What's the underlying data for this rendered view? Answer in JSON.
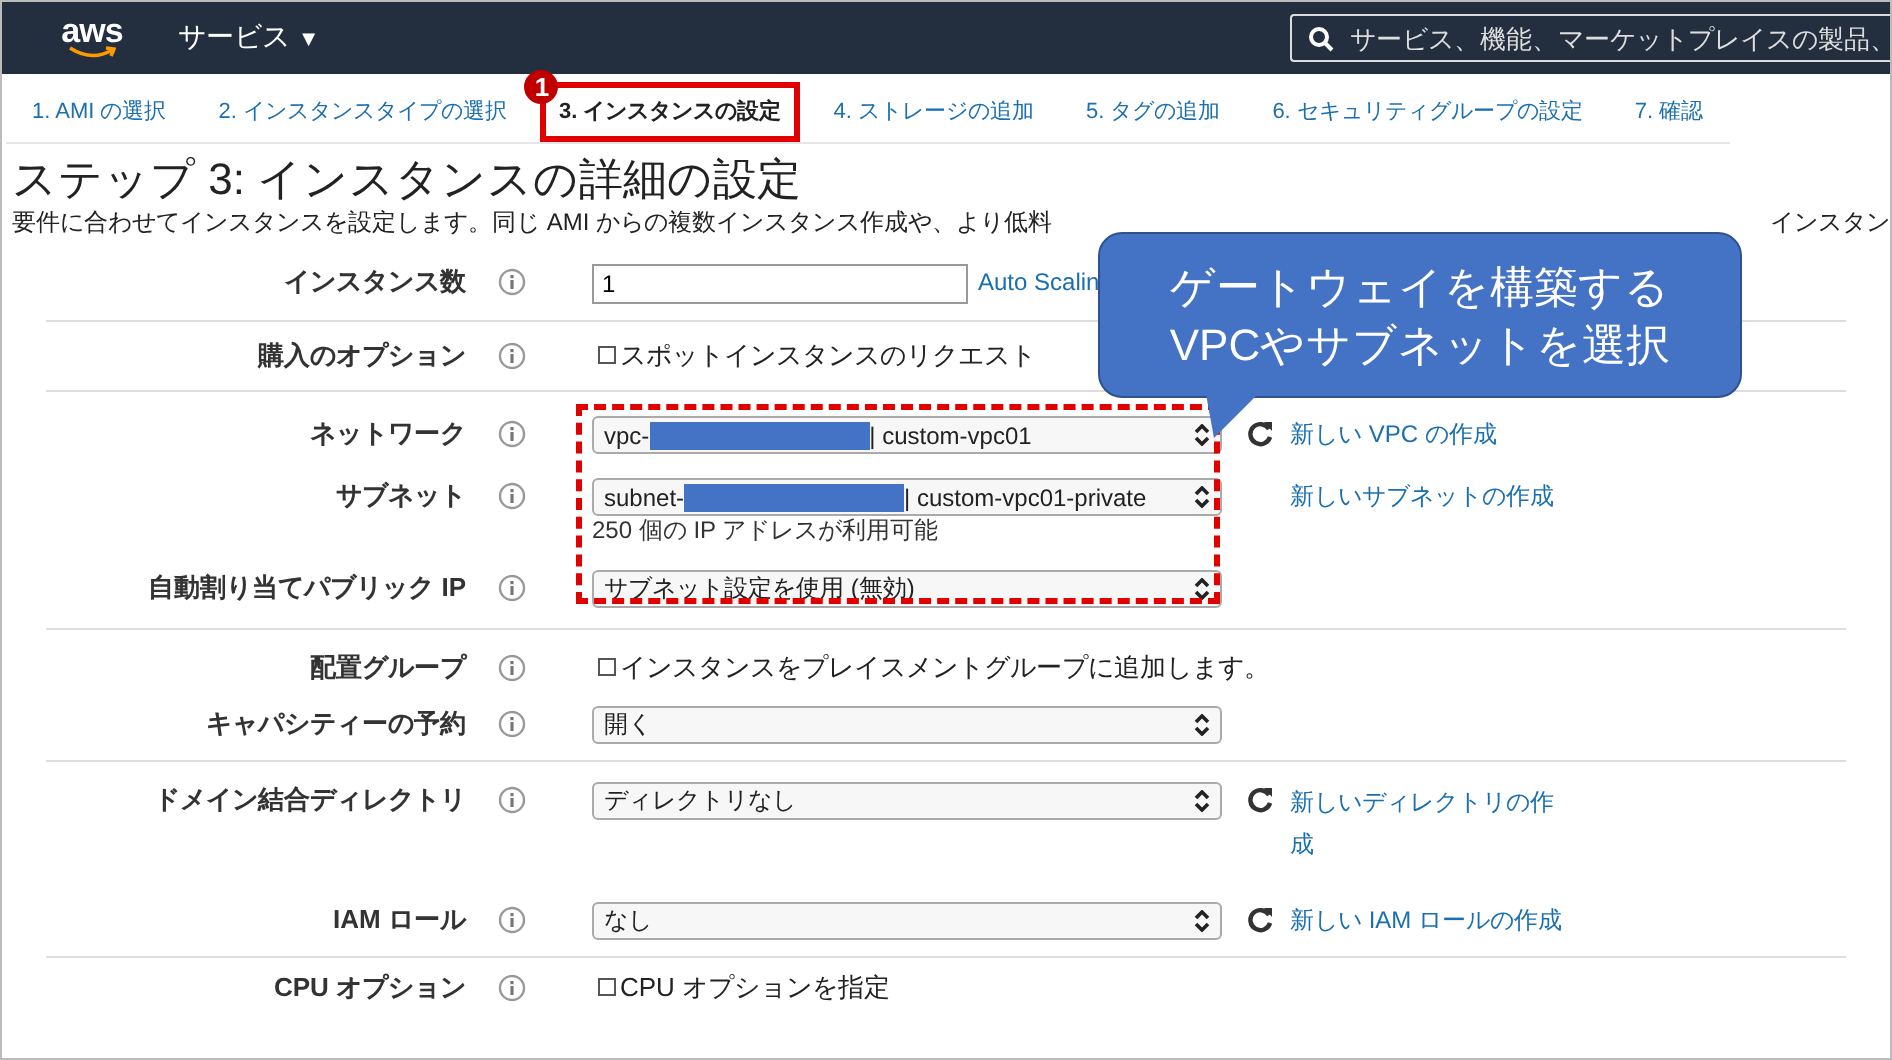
{
  "header": {
    "logo": "aws",
    "services_menu": {
      "label": "サービス",
      "caret": "▼"
    },
    "search": {
      "placeholder": "サービス、機能、マーケットプレイスの製品、"
    }
  },
  "tabs": [
    {
      "label": "1. AMI の選択",
      "selected": false
    },
    {
      "label": "2. インスタンスタイプの選択",
      "selected": false
    },
    {
      "label": "3. インスタンスの設定",
      "selected": true
    },
    {
      "label": "4. ストレージの追加",
      "selected": false
    },
    {
      "label": "5. タグの追加",
      "selected": false
    },
    {
      "label": "6. セキュリティグループの設定",
      "selected": false
    },
    {
      "label": "7. 確認",
      "selected": false
    }
  ],
  "step_badge": "1",
  "title": "ステップ 3: インスタンスの詳細の設定",
  "description": {
    "start": "要件に合わせてインスタンスを設定します。同じ AMI からの複数インスタンス作成や、より低料",
    "end": "インスタン"
  },
  "sections": [
    {
      "rows": [
        {
          "label": "インスタンス数",
          "kind": "input",
          "value": "1",
          "link": "Auto Scalin"
        }
      ]
    },
    {
      "rows": [
        {
          "label": "購入のオプション",
          "kind": "checkbox",
          "text": "スポットインスタンスのリクエスト",
          "checked": false
        }
      ]
    },
    {
      "highlighted": true,
      "rows": [
        {
          "label": "ネットワーク",
          "kind": "select",
          "prefix": "vpc-",
          "redacted": true,
          "value": " | custom-vpc01",
          "refresh": true,
          "link": "新しい VPC の作成"
        },
        {
          "label": "サブネット",
          "kind": "select",
          "prefix": "subnet-",
          "redacted": true,
          "value": " | custom-vpc01-private",
          "refresh": false,
          "link": "新しいサブネットの作成",
          "note": "250 個の IP アドレスが利用可能"
        },
        {
          "label": "自動割り当てパブリック IP",
          "kind": "select",
          "value": "サブネット設定を使用 (無効)",
          "refresh": false
        }
      ]
    },
    {
      "rows": [
        {
          "label": "配置グループ",
          "kind": "checkbox",
          "text": "インスタンスをプレイスメントグループに追加します。",
          "checked": false
        },
        {
          "label": "キャパシティーの予約",
          "kind": "select",
          "value": "開く",
          "refresh": false
        }
      ]
    },
    {
      "rows": [
        {
          "label": "ドメイン結合ディレクトリ",
          "kind": "select",
          "value": "ディレクトリなし",
          "refresh": true,
          "link": "新しいディレクトリの作成",
          "wrap_link": true
        },
        {
          "label": "IAM ロール",
          "kind": "select",
          "value": "なし",
          "refresh": true,
          "link": "新しい IAM ロールの作成"
        }
      ]
    },
    {
      "rows": [
        {
          "label": "CPU オプション",
          "kind": "checkbox",
          "text": "CPU オプションを指定",
          "checked": false
        }
      ]
    }
  ],
  "callout": {
    "lines": [
      "ゲートウェイを構築する",
      "VPCやサブネットを選択"
    ]
  }
}
